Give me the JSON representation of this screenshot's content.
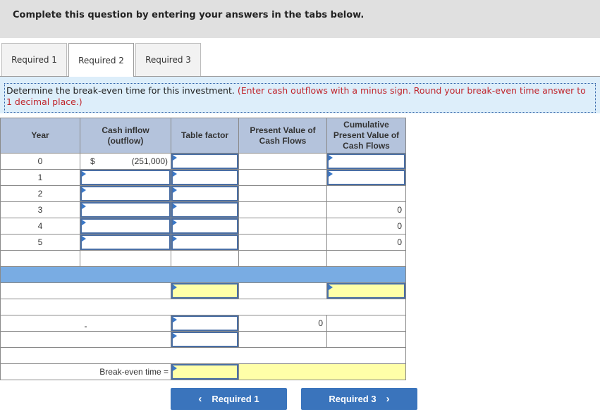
{
  "banner": {
    "title": "Complete this question by entering your answers in the tabs below."
  },
  "tabs": [
    {
      "label": "Required 1",
      "active": false
    },
    {
      "label": "Required 2",
      "active": true
    },
    {
      "label": "Required 3",
      "active": false
    }
  ],
  "instructions": {
    "main": "Determine the break-even time for this investment.",
    "note": "(Enter cash outflows with a minus sign. Round your break-even time answer to 1 decimal place.)"
  },
  "table": {
    "headers": [
      "Year",
      "Cash inflow (outflow)",
      "Table factor",
      "Present Value of Cash Flows",
      "Cumulative Present Value of Cash Flows"
    ],
    "header_lines": {
      "cash": [
        "Cash inflow",
        "(outflow)"
      ],
      "pv": [
        "Present Value of",
        "Cash Flows"
      ],
      "cum": [
        "Cumulative",
        "Present Value of",
        "Cash Flows"
      ]
    },
    "rows": [
      {
        "year": "0",
        "cash_symbol": "$",
        "cash": "(251,000)",
        "factor": "",
        "pv": "",
        "cumulative": ""
      },
      {
        "year": "1",
        "cash": "",
        "factor": "",
        "pv": "",
        "cumulative": ""
      },
      {
        "year": "2",
        "cash": "",
        "factor": "",
        "pv": "",
        "cumulative": ""
      },
      {
        "year": "3",
        "cash": "",
        "factor": "",
        "pv": "",
        "cumulative": "0"
      },
      {
        "year": "4",
        "cash": "",
        "factor": "",
        "pv": "",
        "cumulative": "0"
      },
      {
        "year": "5",
        "cash": "",
        "factor": "",
        "pv": "",
        "cumulative": "0"
      }
    ],
    "calc": {
      "dash": "-",
      "pv_value": "0",
      "break_even_label": "Break-even time ="
    }
  },
  "nav": {
    "prev_label": "Required 1",
    "next_label": "Required 3",
    "prev_icon": "‹",
    "next_icon": "›"
  },
  "colors": {
    "header_bg": "#b4c3dc",
    "bluebar": "#79ace3",
    "input_highlight": "#ffffa8",
    "button": "#3a74bc",
    "note_red": "#c0262d"
  }
}
